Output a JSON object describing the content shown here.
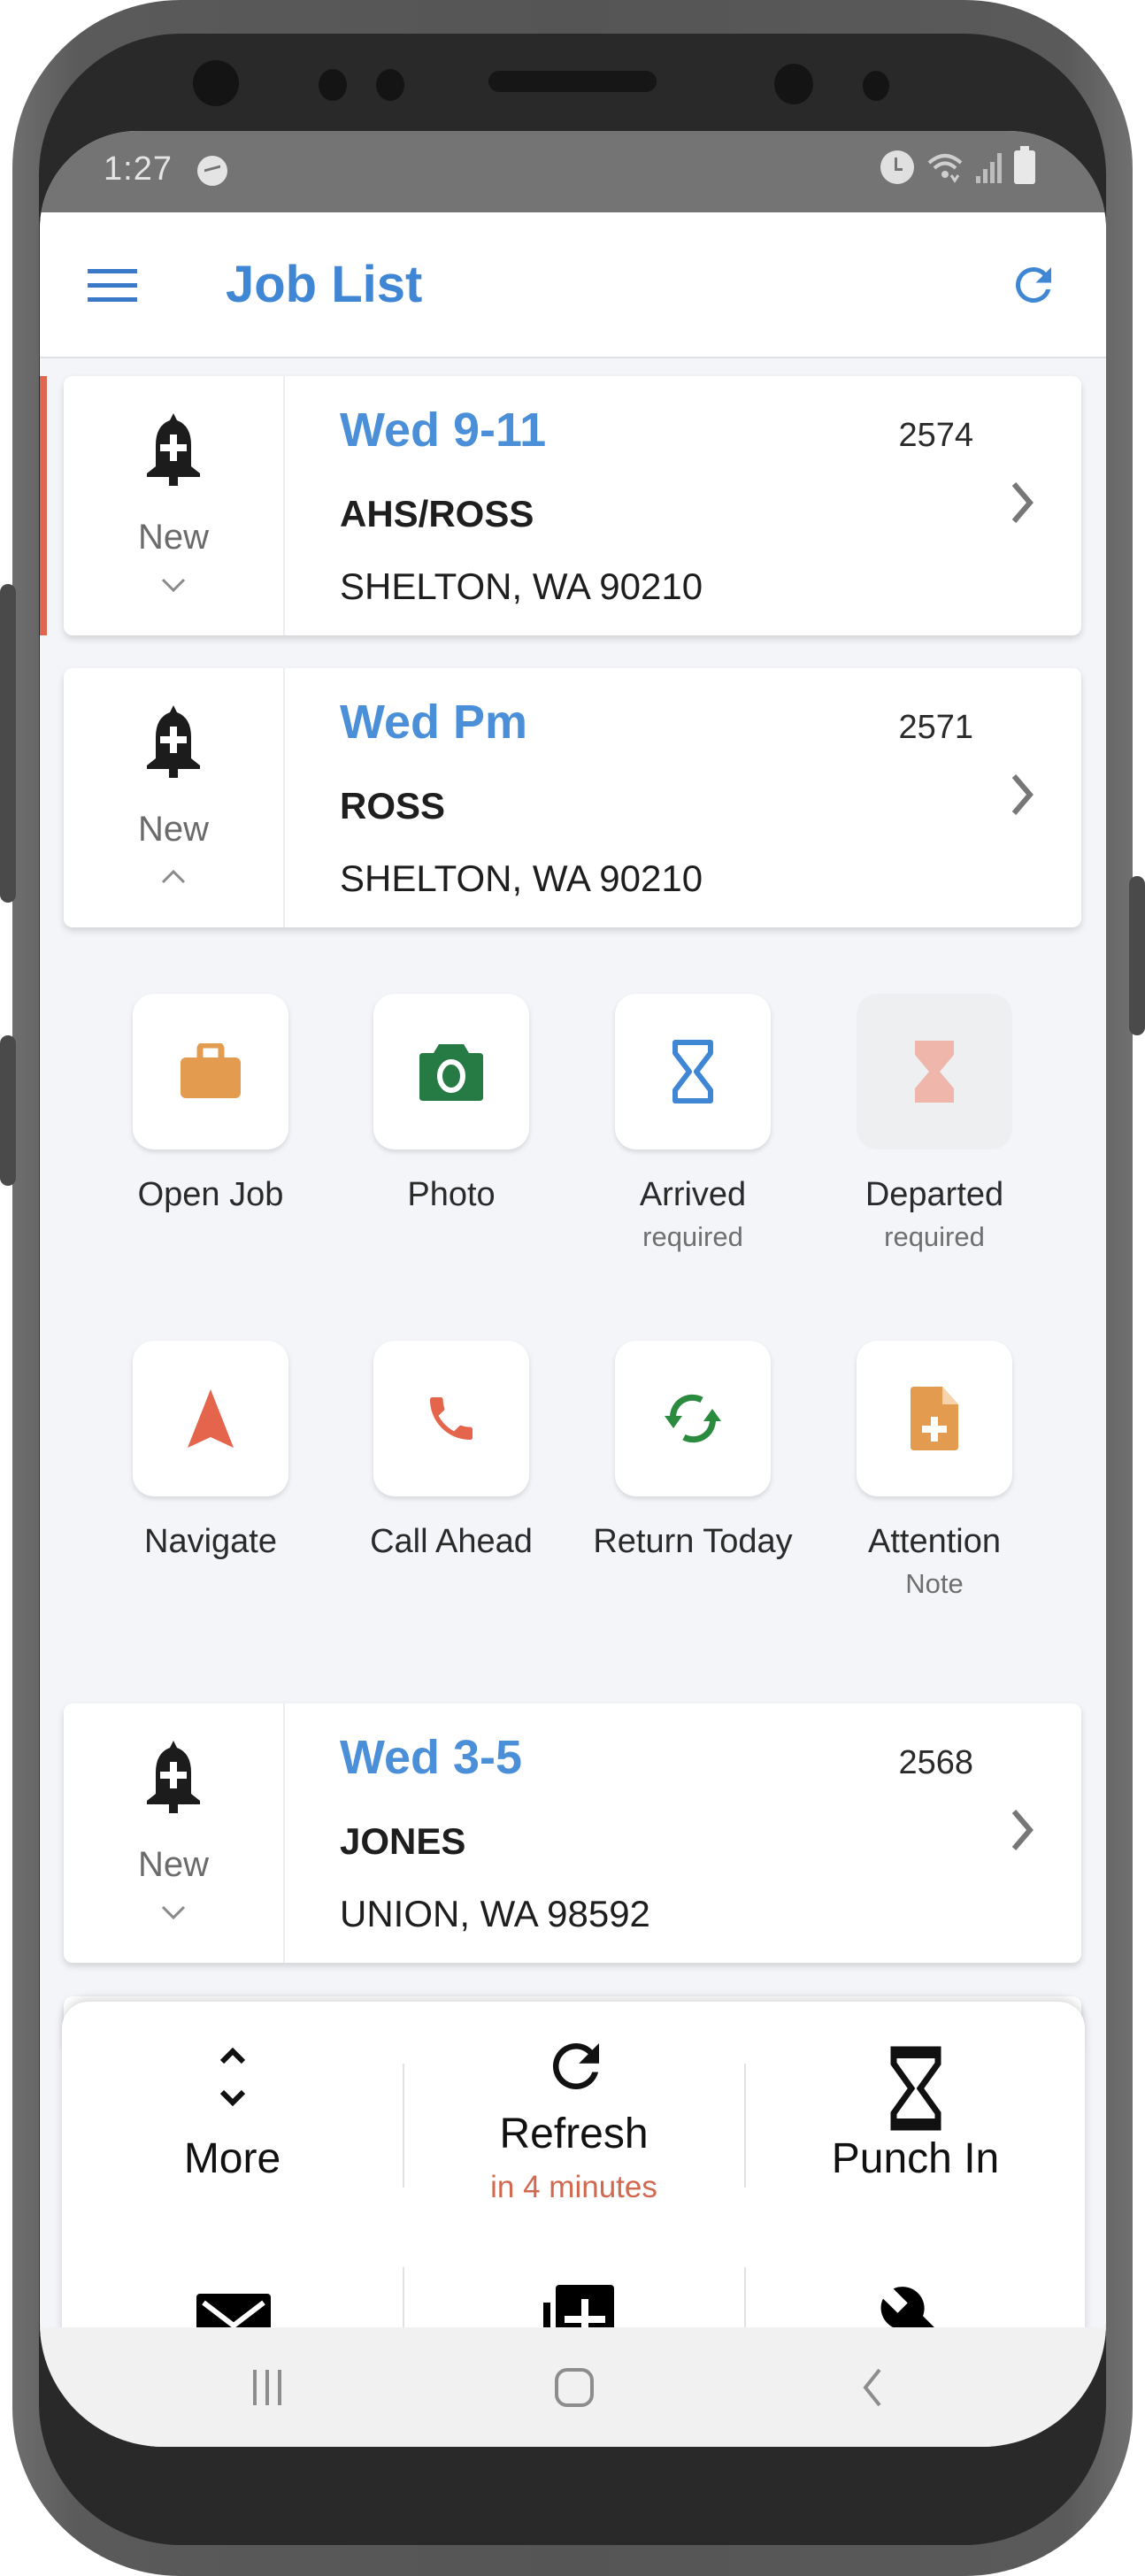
{
  "status_bar": {
    "time": "1:27",
    "icons": [
      "messenger-icon",
      "alarm-icon",
      "wifi-icon",
      "signal-icon",
      "battery-icon"
    ]
  },
  "header": {
    "title": "Job List",
    "menu_icon": "hamburger-icon",
    "refresh_icon": "refresh-icon"
  },
  "colors": {
    "accent_blue": "#3f86d4",
    "job_time_blue": "#4a8fd8",
    "urgent_red": "#e0664f",
    "briefcase_orange": "#e39b4f",
    "camera_green": "#267a43",
    "hourglass_blue": "#3f86d4",
    "hourglass_disabled": "#efb6ab",
    "navigate_red": "#e4644c",
    "phone_red": "#e4644c",
    "return_green": "#2a8a3e",
    "note_orange": "#e39b4f",
    "refresh_countdown": "#d0694f"
  },
  "jobs": [
    {
      "time": "Wed 9-11",
      "number": "2574",
      "client": "AHS/ROSS",
      "address": "SHELTON, WA 90210",
      "status": "New",
      "expanded": false,
      "flagged": true
    },
    {
      "time": "Wed Pm",
      "number": "2571",
      "client": "ROSS",
      "address": "SHELTON, WA 90210",
      "status": "New",
      "expanded": true,
      "flagged": false
    },
    {
      "time": "Wed 3-5",
      "number": "2568",
      "client": "JONES",
      "address": "UNION, WA 98592",
      "status": "New",
      "expanded": false,
      "flagged": false
    }
  ],
  "job_actions": [
    {
      "label": "Open Job",
      "sub": "",
      "icon": "briefcase-icon",
      "enabled": true
    },
    {
      "label": "Photo",
      "sub": "",
      "icon": "camera-icon",
      "enabled": true
    },
    {
      "label": "Arrived",
      "sub": "required",
      "icon": "hourglass-icon",
      "enabled": true
    },
    {
      "label": "Departed",
      "sub": "required",
      "icon": "hourglass-filled-icon",
      "enabled": false
    },
    {
      "label": "Navigate",
      "sub": "",
      "icon": "navigation-arrow-icon",
      "enabled": true
    },
    {
      "label": "Call Ahead",
      "sub": "",
      "icon": "phone-icon",
      "enabled": true
    },
    {
      "label": "Return Today",
      "sub": "",
      "icon": "sync-icon",
      "enabled": true
    },
    {
      "label": "Attention",
      "sub": "Note",
      "icon": "note-add-icon",
      "enabled": true
    }
  ],
  "bottom_sheet": {
    "more": {
      "label": "More",
      "icon": "unfold-icon"
    },
    "refresh": {
      "label": "Refresh",
      "sub": "in 4 minutes",
      "icon": "refresh-icon"
    },
    "punch_in": {
      "label": "Punch In",
      "icon": "hourglass-icon"
    },
    "second_row_icons": [
      "mail-icon",
      "add-box-icon",
      "wrench-icon"
    ]
  },
  "nav_bar": {
    "recents": "recents-icon",
    "home": "home-icon",
    "back": "back-icon"
  }
}
